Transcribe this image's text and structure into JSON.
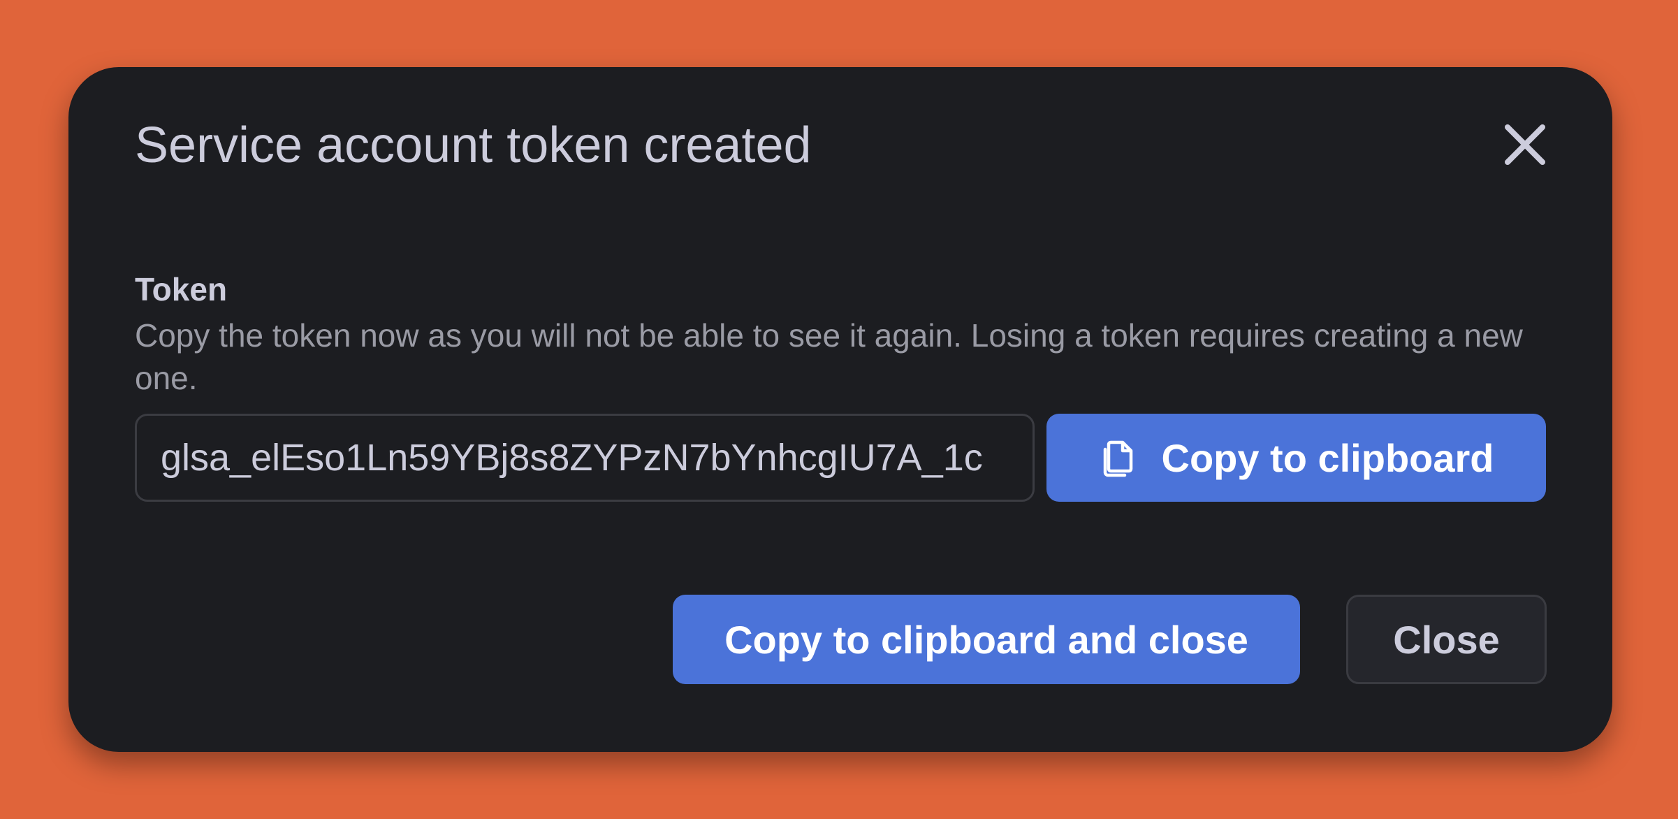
{
  "modal": {
    "title": "Service account token created"
  },
  "token_field": {
    "label": "Token",
    "description": "Copy the token now as you will not be able to see it again. Losing a token requires creating a new one.",
    "value": "glsa_elEso1Ln59YBj8s8ZYPzN7bYnhcgIU7A_1c"
  },
  "buttons": {
    "copy": "Copy to clipboard",
    "copy_and_close": "Copy to clipboard and close",
    "close": "Close"
  },
  "icons": {
    "close": "close-icon",
    "copy": "copy-icon"
  },
  "colors": {
    "background": "#e0643a",
    "modal": "#1c1d21",
    "primary": "#4b73d9"
  }
}
